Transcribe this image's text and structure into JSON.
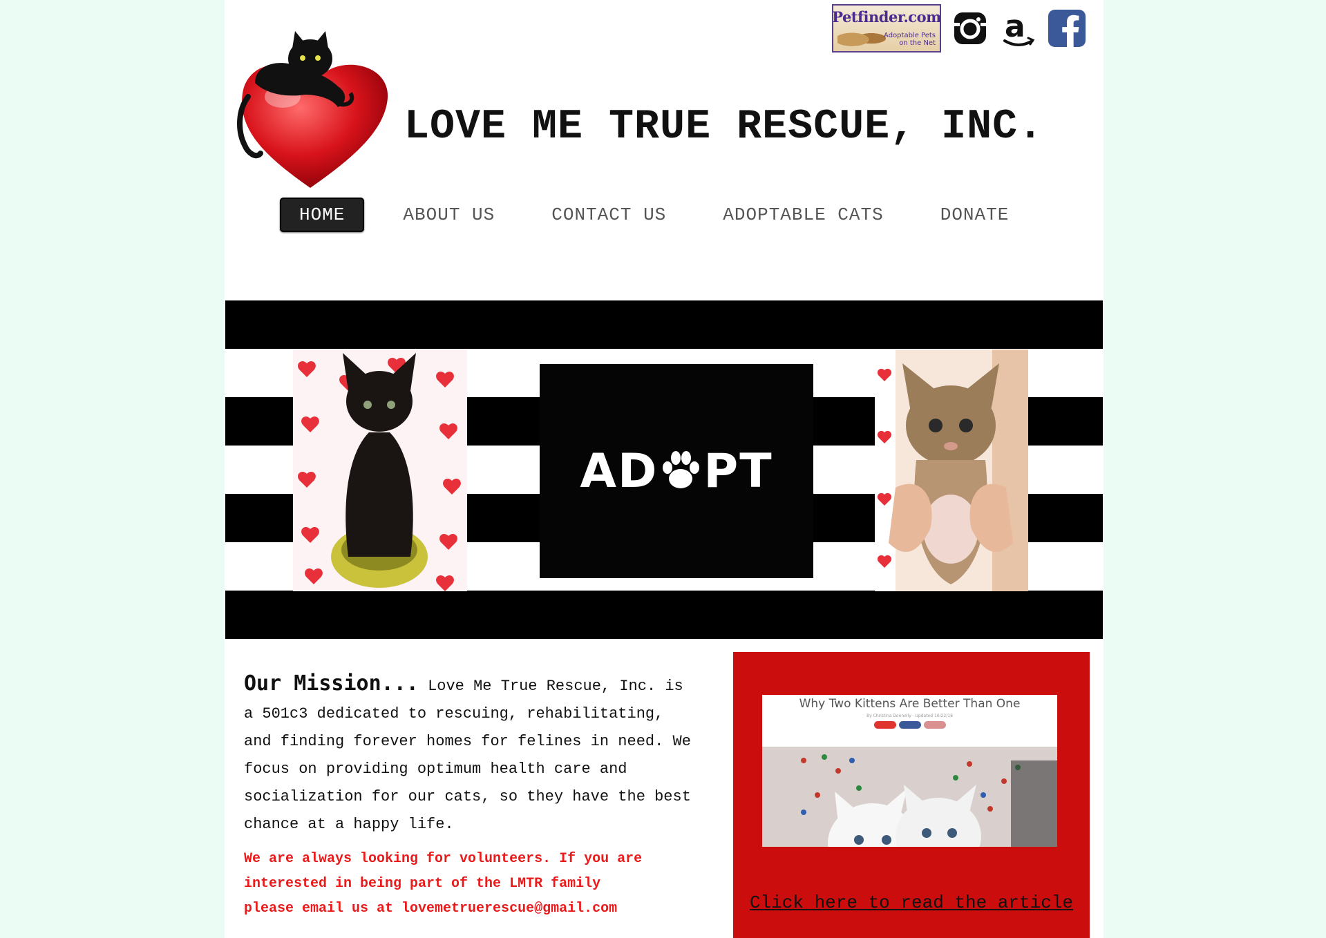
{
  "header": {
    "site_title": "LOVE ME TRUE RESCUE, INC.",
    "petfinder": {
      "title": "Petfinder.com",
      "subtitle": "Adoptable Pets\non the Net"
    },
    "social_icons": [
      "instagram-icon",
      "amazon-icon",
      "facebook-icon"
    ]
  },
  "nav": {
    "items": [
      {
        "label": "HOME",
        "active": true
      },
      {
        "label": "ABOUT US",
        "active": false
      },
      {
        "label": "CONTACT US",
        "active": false
      },
      {
        "label": "ADOPTABLE CATS",
        "active": false
      },
      {
        "label": "DONATE",
        "active": false
      }
    ]
  },
  "banner": {
    "adopt_left": "AD",
    "adopt_right": "PT"
  },
  "mission": {
    "heading": "Our Mission...",
    "text": "Love Me True Rescue, Inc. is a 501c3 dedicated to rescuing, rehabilitating, and finding forever homes for felines in need. We focus on providing optimum health care and socialization for our cats, so they have the best chance at a happy life.",
    "volunteer_line1": "We are always looking for volunteers. If you are",
    "volunteer_line2": "interested in being part of the LMTR family",
    "volunteer_line3": "please email us at lovemetruerescue@gmail.com"
  },
  "article": {
    "title": "Why Two Kittens Are Better Than One",
    "meta": "By Christina Donnelly · Updated 10/22/18",
    "link_text": "Click here to read the article"
  },
  "colors": {
    "page_bg": "#eafcf4",
    "accent_red": "#cc0d0d",
    "volunteer_red": "#e81a1a",
    "nav_active": "#222222"
  }
}
